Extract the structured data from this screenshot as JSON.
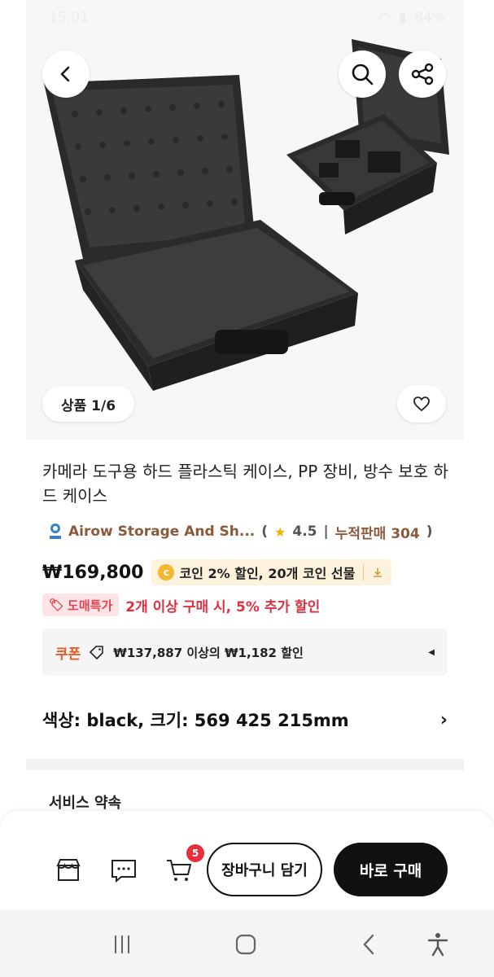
{
  "status_bar": {
    "time": "15:01",
    "battery": "84%"
  },
  "hero": {
    "image_counter": "상품 1/6",
    "icons": {
      "back": "back-icon",
      "search": "search-icon",
      "share": "share-icon",
      "wishlist": "heart-icon"
    }
  },
  "product": {
    "title": "카메라 도구용 하드 플라스틱 케이스, PP 장비, 방수 보호 하드 케이스",
    "seller_name": "Airow Storage And Sh...",
    "rating": "4.5",
    "sales_label": "누적판매 304",
    "price": "₩169,800",
    "coin_text": "코인 2% 할인, 20개 코인 선물",
    "deal_badge": "도매특가",
    "deal_text": "2개 이상 구매 시, 5% 추가 할인",
    "coupon_label": "쿠폰",
    "coupon_desc": "₩137,887 이상의 ₩1,182 할인",
    "option_text": "색상: black, 크기: 569 425 215mm"
  },
  "service": {
    "title": "서비스 약속"
  },
  "bottom_bar": {
    "cart_count": "5",
    "add_to_cart": "장바구니 담기",
    "buy_now": "바로 구매",
    "icons": [
      "store-icon",
      "chat-icon",
      "cart-icon"
    ]
  },
  "colors": {
    "deal_red": "#e0303f",
    "seller_brown": "#8a5a3a",
    "coupon_orange": "#e85a2a",
    "buy_black": "#111111",
    "badge_red": "#e8303a"
  }
}
